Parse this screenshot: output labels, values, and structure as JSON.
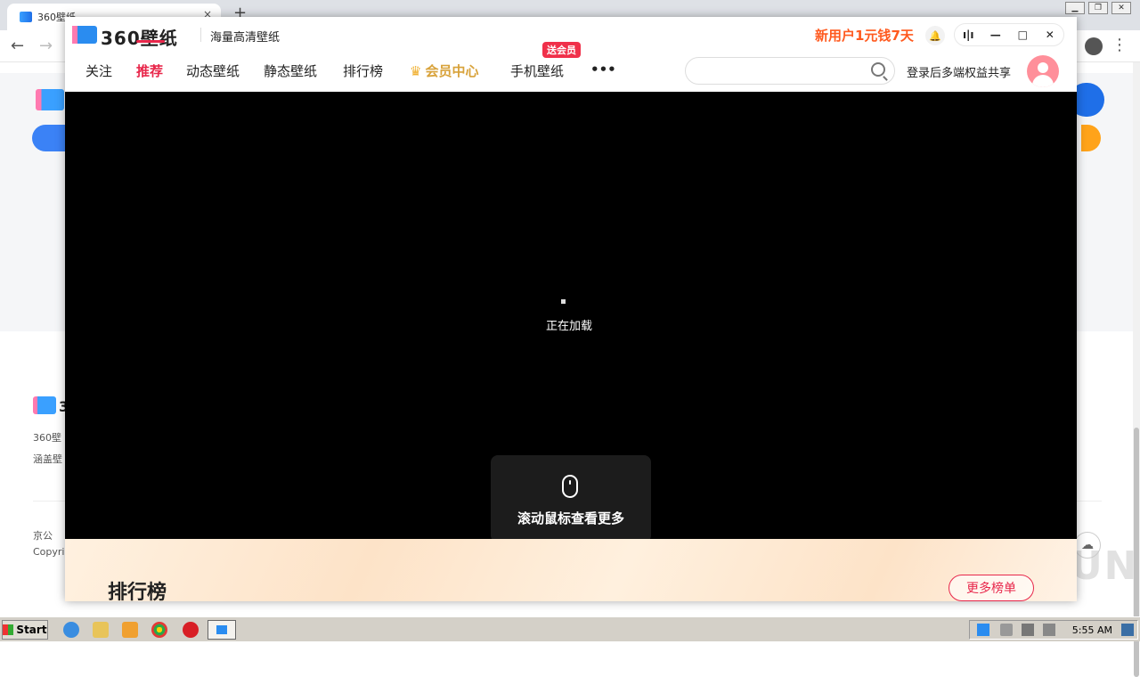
{
  "browser": {
    "tab_title": "360壁纸",
    "tab_close": "×",
    "new_tab": "+",
    "back": "←",
    "forward": "→",
    "menu": "⋮"
  },
  "background_page": {
    "footer_text_1": "360壁",
    "footer_text_2": "涵盖壁",
    "footer_text_3": "京公",
    "footer_text_4": "Copyri",
    "footer_logo_text": "3"
  },
  "app": {
    "name": "360壁纸",
    "slogan": "海量高清壁纸",
    "promo": "新用户1元钱7天",
    "window_controls": [
      "ı|ı",
      "—",
      "□",
      "✕"
    ],
    "nav": [
      {
        "label": "关注"
      },
      {
        "label": "推荐",
        "active": true
      },
      {
        "label": "动态壁纸"
      },
      {
        "label": "静态壁纸"
      },
      {
        "label": "排行榜"
      },
      {
        "label": "会员中心"
      },
      {
        "label": "手机壁纸"
      },
      {
        "label": "•••"
      }
    ],
    "badge": "送会员",
    "search_placeholder": "",
    "login_text": "登录后多端权益共享",
    "loading_text": "正在加载",
    "scroll_hint": "滚动鼠标查看更多",
    "rank_title": "排行榜",
    "more_button": "更多榜单"
  },
  "taskbar": {
    "start_label": "Start",
    "clock": "5:55 AM"
  },
  "watermark": "ANY RUN",
  "colors": {
    "accent_red": "#e8274b",
    "promo_orange": "#ff5a1f",
    "vip_gold": "#d8a23a",
    "brand_blue": "#2a8cf0"
  }
}
